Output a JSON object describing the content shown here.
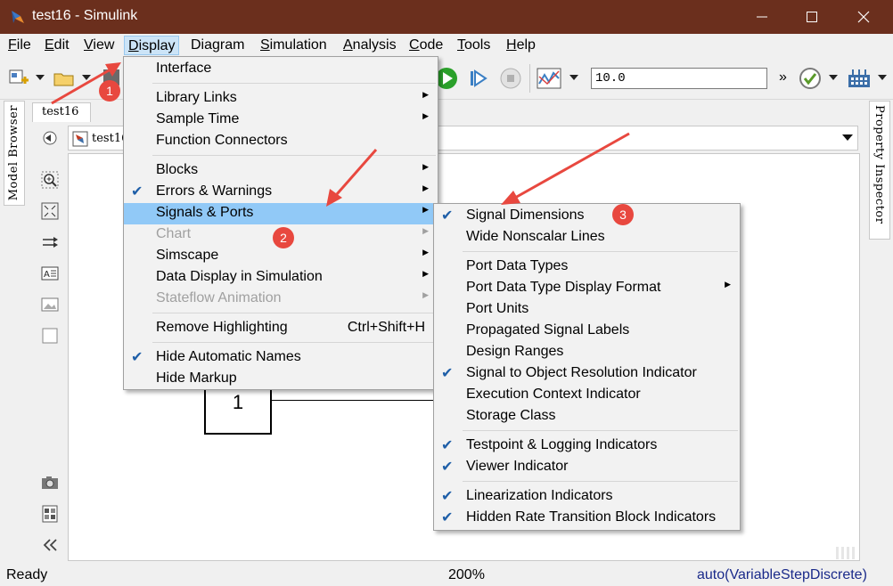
{
  "window": {
    "title": "test16 - Simulink",
    "controls": [
      "minimize",
      "maximize",
      "close"
    ]
  },
  "menubar": [
    {
      "label": "File",
      "u": "F"
    },
    {
      "label": "Edit",
      "u": "E"
    },
    {
      "label": "View",
      "u": "V"
    },
    {
      "label": "Display",
      "u": "D"
    },
    {
      "label": "Diagram",
      "u": "g"
    },
    {
      "label": "Simulation",
      "u": "S"
    },
    {
      "label": "Analysis",
      "u": "A"
    },
    {
      "label": "Code",
      "u": "C"
    },
    {
      "label": "Tools",
      "u": "T"
    },
    {
      "label": "Help",
      "u": "H"
    }
  ],
  "toolbar": {
    "stop_time": "10.0",
    "overflow": "»"
  },
  "side": {
    "model_browser": "Model Browser",
    "property_inspector": "Property Inspector"
  },
  "tabs": {
    "model_tab": "test16",
    "breadcrumb": "test16"
  },
  "canvas": {
    "block_label": "1"
  },
  "status": {
    "ready": "Ready",
    "zoom": "200%",
    "solver": "auto(VariableStepDiscrete)"
  },
  "display_menu": {
    "items": [
      {
        "label": "Interface",
        "checked": false,
        "submenu": false,
        "disabled": false
      },
      {
        "label": "Library Links",
        "checked": false,
        "submenu": true,
        "disabled": false
      },
      {
        "label": "Sample Time",
        "checked": false,
        "submenu": true,
        "disabled": false
      },
      {
        "label": "Function Connectors",
        "checked": false,
        "submenu": false,
        "disabled": false
      },
      {
        "label": "Blocks",
        "checked": false,
        "submenu": true,
        "disabled": false
      },
      {
        "label": "Errors & Warnings",
        "checked": true,
        "submenu": true,
        "disabled": false
      },
      {
        "label": "Signals & Ports",
        "checked": false,
        "submenu": true,
        "disabled": false,
        "highlighted": true
      },
      {
        "label": "Chart",
        "checked": false,
        "submenu": true,
        "disabled": true
      },
      {
        "label": "Simscape",
        "checked": false,
        "submenu": true,
        "disabled": false
      },
      {
        "label": "Data Display in Simulation",
        "checked": false,
        "submenu": true,
        "disabled": false
      },
      {
        "label": "Stateflow Animation",
        "checked": false,
        "submenu": true,
        "disabled": true
      },
      {
        "label": "Remove Highlighting",
        "checked": false,
        "submenu": false,
        "disabled": false,
        "shortcut": "Ctrl+Shift+H"
      },
      {
        "label": "Hide Automatic Names",
        "checked": true,
        "submenu": false,
        "disabled": false
      },
      {
        "label": "Hide Markup",
        "checked": false,
        "submenu": false,
        "disabled": false
      }
    ]
  },
  "signals_menu": {
    "items": [
      {
        "label": "Signal Dimensions",
        "checked": true,
        "submenu": false
      },
      {
        "label": "Wide Nonscalar Lines",
        "checked": false,
        "submenu": false
      },
      {
        "label": "Port Data Types",
        "checked": false,
        "submenu": false
      },
      {
        "label": "Port Data Type Display Format",
        "checked": false,
        "submenu": true
      },
      {
        "label": "Port Units",
        "checked": false,
        "submenu": false
      },
      {
        "label": "Propagated Signal Labels",
        "checked": false,
        "submenu": false
      },
      {
        "label": "Design Ranges",
        "checked": false,
        "submenu": false
      },
      {
        "label": "Signal to Object Resolution Indicator",
        "checked": true,
        "submenu": false
      },
      {
        "label": "Execution Context Indicator",
        "checked": false,
        "submenu": false
      },
      {
        "label": "Storage Class",
        "checked": false,
        "submenu": false
      },
      {
        "label": "Testpoint & Logging Indicators",
        "checked": true,
        "submenu": false
      },
      {
        "label": "Viewer Indicator",
        "checked": true,
        "submenu": false
      },
      {
        "label": "Linearization Indicators",
        "checked": true,
        "submenu": false
      },
      {
        "label": "Hidden Rate Transition Block Indicators",
        "checked": true,
        "submenu": false
      }
    ]
  },
  "annotations": {
    "badge1": "1",
    "badge2": "2",
    "badge3": "3",
    "color": "#e8483f"
  },
  "colors": {
    "titlebar": "#6b2f1d",
    "highlight": "#91c9f7",
    "check": "#1f5fa8",
    "solver_text": "#1a2a8a"
  }
}
